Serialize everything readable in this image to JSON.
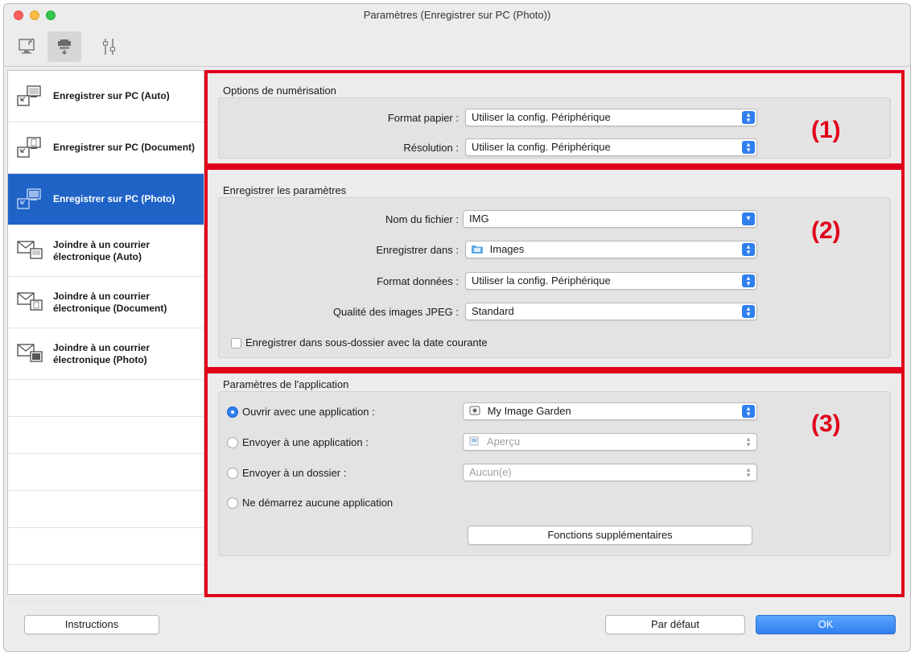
{
  "window": {
    "title": "Paramètres (Enregistrer sur PC (Photo))"
  },
  "toolbar": {
    "tabs": [
      {
        "icon": "scan-from-computer-icon"
      },
      {
        "icon": "scan-from-panel-icon",
        "active": true
      },
      {
        "icon": "general-settings-icon"
      }
    ]
  },
  "sidebar": {
    "items": [
      {
        "label": "Enregistrer sur PC (Auto)",
        "selected": false
      },
      {
        "label": "Enregistrer sur PC (Document)",
        "selected": false
      },
      {
        "label": "Enregistrer sur PC (Photo)",
        "selected": true
      },
      {
        "label": "Joindre à un courrier électronique (Auto)",
        "selected": false
      },
      {
        "label": "Joindre à un courrier électronique (Document)",
        "selected": false
      },
      {
        "label": "Joindre à un courrier électronique (Photo)",
        "selected": false
      }
    ]
  },
  "section1": {
    "number": "(1)",
    "title": "Options de numérisation",
    "paper_label": "Format papier :",
    "paper_value": "Utiliser la config. Périphérique",
    "resolution_label": "Résolution :",
    "resolution_value": "Utiliser la config. Périphérique"
  },
  "section2": {
    "number": "(2)",
    "title": "Enregistrer les paramètres",
    "filename_label": "Nom du fichier :",
    "filename_value": "IMG",
    "savein_label": "Enregistrer dans :",
    "savein_value": "Images",
    "format_label": "Format données :",
    "format_value": "Utiliser la config. Périphérique",
    "jpeg_label": "Qualité des images JPEG :",
    "jpeg_value": "Standard",
    "subfolder_label": "Enregistrer dans sous-dossier avec la date courante",
    "subfolder_checked": false
  },
  "section3": {
    "number": "(3)",
    "title": "Paramètres de l'application",
    "open_app_label": "Ouvrir avec une application :",
    "open_app_value": "My Image Garden",
    "send_app_label": "Envoyer à une application :",
    "send_app_value": "Aperçu",
    "send_folder_label": "Envoyer à un dossier :",
    "send_folder_value": "Aucun(e)",
    "no_app_label": "Ne démarrez aucune application",
    "selected_option": "open_app",
    "more_button": "Fonctions supplémentaires"
  },
  "footer": {
    "instructions": "Instructions",
    "defaults": "Par défaut",
    "ok": "OK"
  },
  "colors": {
    "accent": "#2f7ff0",
    "selection": "#1f63c7",
    "highlight_box": "#e0001b"
  }
}
